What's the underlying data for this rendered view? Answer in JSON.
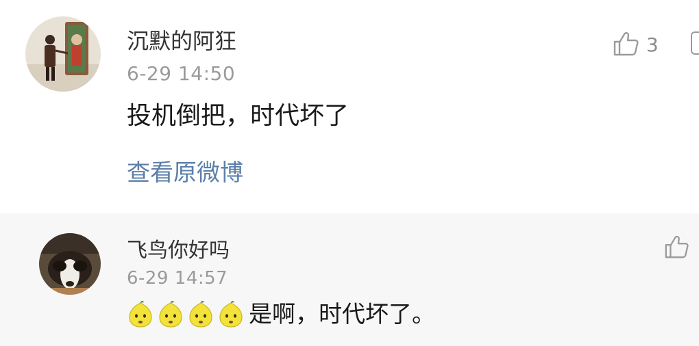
{
  "comments": [
    {
      "username": "沉默的阿狂",
      "timestamp": "6-29 14:50",
      "text": "投机倒把，时代坏了",
      "link": "查看原微博",
      "like_count": "3"
    },
    {
      "username": "飞鸟你好吗",
      "timestamp": "6-29 14:57",
      "emojis": [
        "lemon-face-emoji",
        "lemon-face-emoji",
        "lemon-face-emoji",
        "lemon-face-emoji"
      ],
      "text": "是啊，时代坏了。"
    }
  ],
  "colors": {
    "username": "#333333",
    "timestamp": "#9a9a9a",
    "link": "#5b7fa8",
    "icon": "#9a9a9a",
    "reply_bg": "#f7f7f7"
  }
}
